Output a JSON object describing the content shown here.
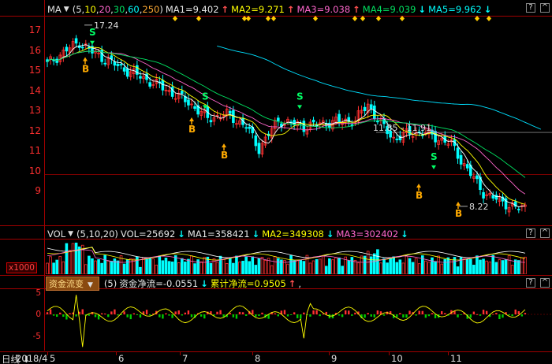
{
  "ma_header": {
    "name": "MA",
    "params_open": "(",
    "params": [
      "5",
      "10",
      "20",
      "30",
      "60",
      "250"
    ],
    "params_close": ")",
    "values": [
      {
        "label": "MA1=9.402",
        "arrow": "↑",
        "dir": "up"
      },
      {
        "label": "MA2=9.271",
        "arrow": "↑",
        "dir": "up"
      },
      {
        "label": "MA3=9.038",
        "arrow": "↑",
        "dir": "up"
      },
      {
        "label": "MA4=9.039",
        "arrow": "↓",
        "dir": "down"
      },
      {
        "label": "MA5=9.962",
        "arrow": "↓",
        "dir": "down"
      }
    ]
  },
  "vol_header": {
    "name": "VOL",
    "params": "(5,10,20)",
    "values": [
      {
        "label": "VOL=25692",
        "arrow": "↓",
        "dir": "down"
      },
      {
        "label": "MA1=358421",
        "arrow": "↓",
        "dir": "down"
      },
      {
        "label": "MA2=349308",
        "arrow": "↓",
        "dir": "down"
      },
      {
        "label": "MA3=302402",
        "arrow": "↓",
        "dir": "down"
      }
    ]
  },
  "fund_header": {
    "button": "资金流变",
    "params": "(5)",
    "net_label": "资金净流=-0.0551",
    "net_arrow": "↓",
    "cum_label": "累计净流=0.9505",
    "cum_arrow": "↑",
    "tail": ","
  },
  "price_axis": [
    "17",
    "16",
    "15",
    "14",
    "13",
    "12",
    "11",
    "10",
    "9"
  ],
  "vol_axis_unit": "x1000",
  "fund_axis": [
    "5",
    "0",
    "-5"
  ],
  "annotations": {
    "high": "17.24",
    "range": "11.85 - 11.91",
    "low": "8.22"
  },
  "signals": {
    "buy": "B",
    "sell": "S"
  },
  "x_axis": {
    "period_menu": "日线",
    "labels": [
      "2018/4",
      "5",
      "6",
      "7",
      "8",
      "9",
      "10",
      "11"
    ]
  },
  "window_buttons": {
    "help": "?",
    "expand": "^"
  },
  "colors": {
    "up": "#ff3030",
    "down": "#00ffff",
    "ma1": "#ffffff",
    "ma2": "#ffff00",
    "ma3": "#ff66cc",
    "ma4": "#00e060",
    "ma5": "#00e0ff",
    "grid": "#a00000",
    "buy": "#ffaa00",
    "sell": "#00ff66"
  }
}
